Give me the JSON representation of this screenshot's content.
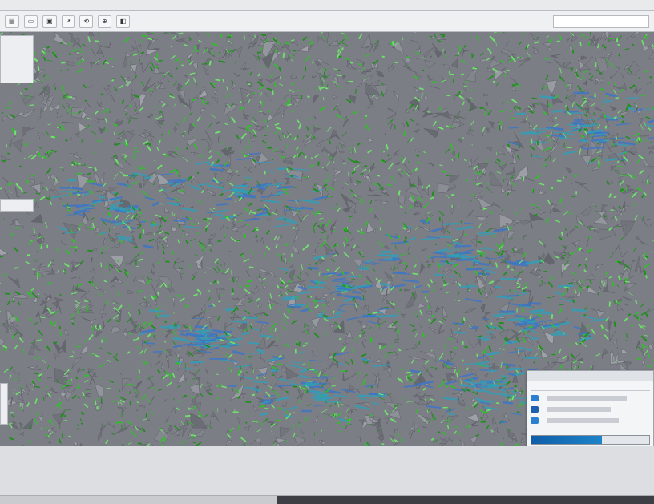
{
  "window": {
    "title": "",
    "colors": {
      "background": "#d7d9dc",
      "viewport_gray": "#7a7c84",
      "mesh_green": "#2fbf2a",
      "mesh_blue": "#3b76c8"
    }
  },
  "toolbar": {
    "buttons": [
      "",
      "",
      "",
      "",
      "",
      "",
      ""
    ],
    "search_value": ""
  },
  "viewport": {
    "content": "3d-mesh-visualization"
  },
  "panel": {
    "title": "",
    "progress": 0.6
  }
}
